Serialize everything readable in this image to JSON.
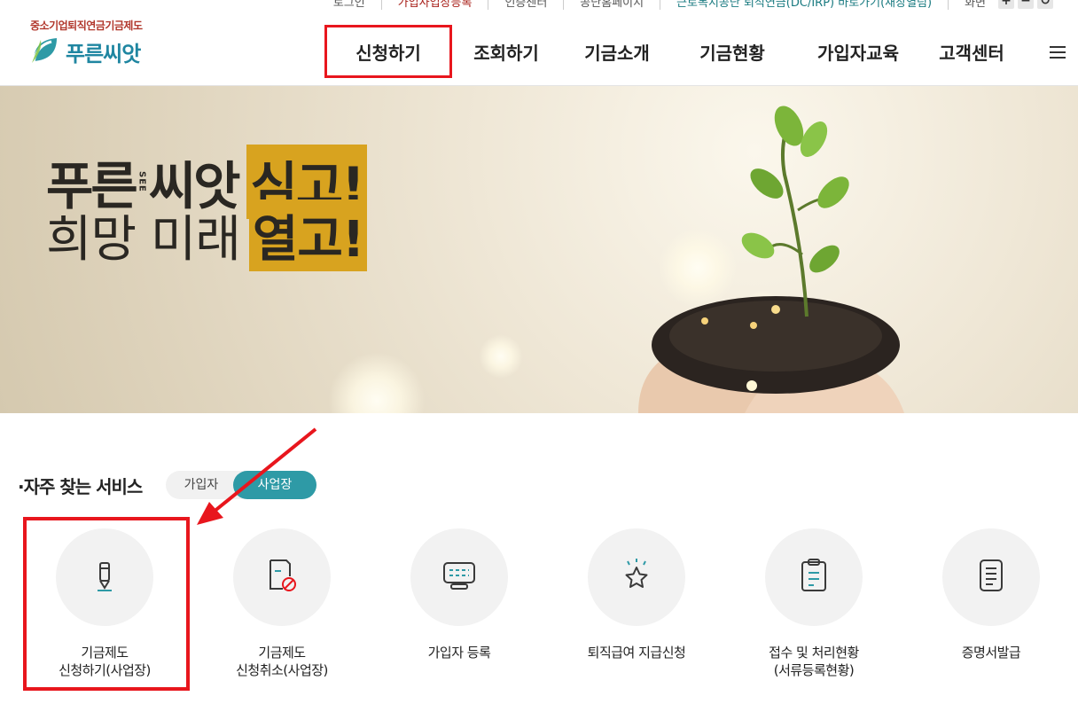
{
  "util_nav": {
    "login": "로그인",
    "register": "가입사업장등록",
    "auth_center": "인증센터",
    "gongdan": "공단홈페이지",
    "irp": "근로복지공단 퇴직연금(DC/IRP) 바로가기(새창열림)",
    "zoom_label": "화면",
    "zoom_in": "+",
    "zoom_out": "−",
    "zoom_reset": "↻"
  },
  "logo": {
    "org": "중소기업퇴직연금기금제도",
    "brand": "푸른씨앗"
  },
  "gnb": {
    "items": [
      "신청하기",
      "조회하기",
      "기금소개",
      "기금현황",
      "가입자교육",
      "고객센터"
    ]
  },
  "hero": {
    "line1_a": "푸른",
    "line1_b": "씨앗",
    "see": "SEE",
    "line1_hl": "심고!",
    "line2_a": "희망 미래",
    "line2_hl": "열고!"
  },
  "section": {
    "title": "·자주 찾는 서비스",
    "toggle_member": "가입자",
    "toggle_workplace": "사업장"
  },
  "services": [
    {
      "label": "기금제도\n신청하기(사업장)",
      "icon": "pencil-icon"
    },
    {
      "label": "기금제도\n신청취소(사업장)",
      "icon": "document-cancel-icon"
    },
    {
      "label": "가입자 등록",
      "icon": "monitor-icon"
    },
    {
      "label": "퇴직급여 지급신청",
      "icon": "star-icon"
    },
    {
      "label": "접수 및 처리현황\n(서류등록현황)",
      "icon": "clipboard-icon"
    },
    {
      "label": "증명서발급",
      "icon": "certificate-icon"
    }
  ],
  "colors": {
    "accent": "#2e9aa6",
    "highlight": "#e8161d",
    "slogan_bg": "#d8a31f"
  }
}
